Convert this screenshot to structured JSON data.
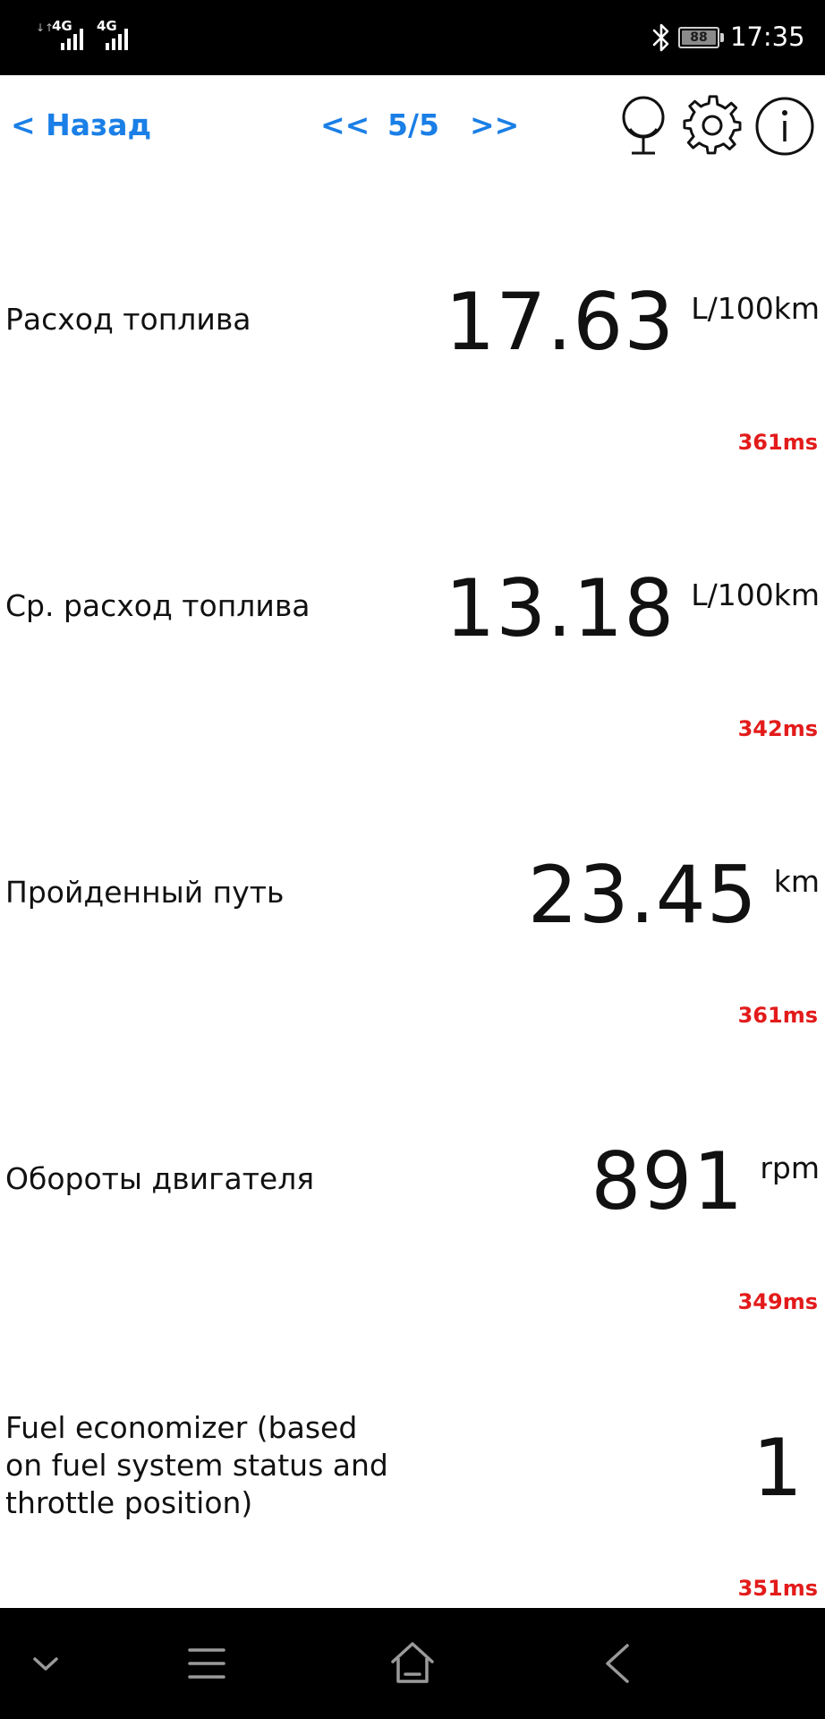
{
  "status_bar": {
    "signal_1": "4G",
    "signal_2": "4G",
    "battery": "88",
    "time": "17:35"
  },
  "toolbar": {
    "back_label": "< Назад",
    "prev_label": "<<",
    "page": "5/5",
    "next_label": ">>",
    "icons": [
      "microphone-icon",
      "gear-icon",
      "info-icon"
    ],
    "accent_color": "#1a7fe6"
  },
  "params": [
    {
      "label": "Расход топлива",
      "value": "17.63",
      "unit": "L/100km",
      "latency": "361ms"
    },
    {
      "label": "Ср. расход топлива",
      "value": "13.18",
      "unit": "L/100km",
      "latency": "342ms"
    },
    {
      "label": "Пройденный путь",
      "value": "23.45",
      "unit": "km",
      "latency": "361ms"
    },
    {
      "label": "Обороты двигателя",
      "value": "891",
      "unit": "rpm",
      "latency": "349ms"
    },
    {
      "label": "Fuel economizer (based on fuel system status and throttle position)",
      "value": "1",
      "unit": "",
      "latency": "351ms"
    }
  ],
  "latency_color": "#e31b1b",
  "nav_bar": {
    "icons": [
      "chevron-down-icon",
      "menu-icon",
      "home-icon",
      "back-icon"
    ]
  }
}
